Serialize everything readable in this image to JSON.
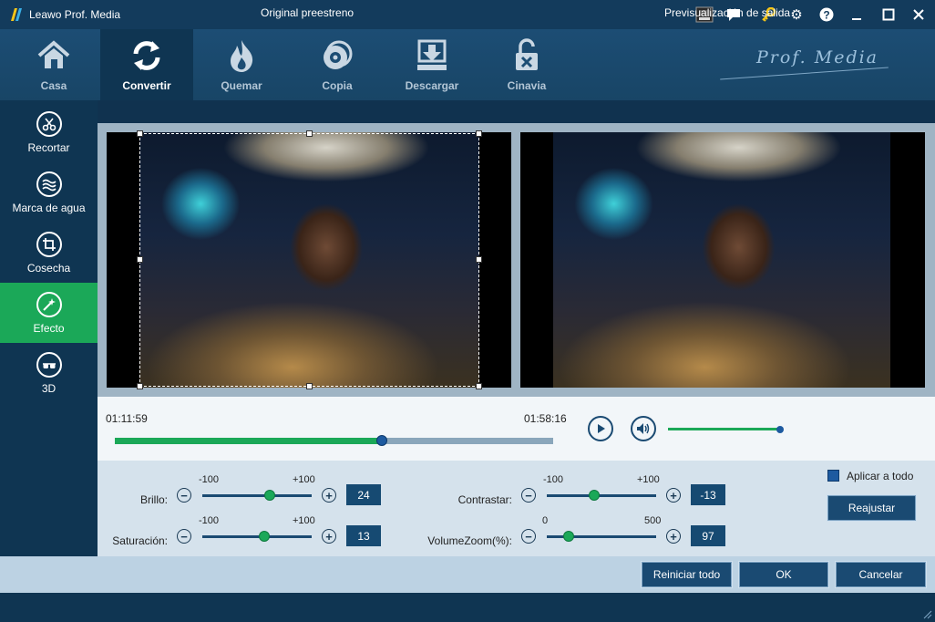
{
  "window": {
    "title": "Leawo Prof. Media",
    "controls": [
      "amd-badge-icon",
      "chat-icon",
      "key-icon",
      "gear-icon",
      "help-icon",
      "minimize-icon",
      "maximize-icon",
      "close-icon"
    ]
  },
  "nav": {
    "items": [
      {
        "label": "Casa",
        "icon": "home-icon"
      },
      {
        "label": "Convertir",
        "icon": "convert-icon",
        "active": true
      },
      {
        "label": "Quemar",
        "icon": "burn-icon"
      },
      {
        "label": "Copia",
        "icon": "copy-disc-icon"
      },
      {
        "label": "Descargar",
        "icon": "download-icon"
      },
      {
        "label": "Cinavia",
        "icon": "cinavia-unlock-icon"
      }
    ],
    "brand": "Prof. Media"
  },
  "sidebar": {
    "items": [
      {
        "label": "Recortar",
        "icon": "scissors-icon"
      },
      {
        "label": "Marca de agua",
        "icon": "watermark-icon"
      },
      {
        "label": "Cosecha",
        "icon": "crop-icon"
      },
      {
        "label": "Efecto",
        "icon": "effect-wand-icon",
        "active": true
      },
      {
        "label": "3D",
        "icon": "3d-glasses-icon"
      }
    ]
  },
  "preview": {
    "original_label": "Original preestreno",
    "output_label": "Previsualización de salida"
  },
  "timeline": {
    "current_time": "01:11:59",
    "total_time": "01:58:16",
    "progress": 0.61,
    "volume": 1.0
  },
  "settings": {
    "brightness": {
      "label": "Brillo:",
      "min": "-100",
      "max": "+100",
      "value": "24"
    },
    "saturation": {
      "label": "Saturación:",
      "min": "-100",
      "max": "+100",
      "value": "13"
    },
    "contrast": {
      "label": "Contrastar:",
      "min": "-100",
      "max": "+100",
      "value": "-13"
    },
    "volume_zoom": {
      "label": "VolumeZoom(%):",
      "min": "0",
      "max": "500",
      "value": "97"
    },
    "apply_all_label": "Aplicar a todo",
    "reset_label": "Reajustar"
  },
  "footer": {
    "reset_all_label": "Reiniciar todo",
    "ok_label": "OK",
    "cancel_label": "Cancelar"
  },
  "colors": {
    "accent_green": "#1ba858",
    "dark_blue": "#0f3552",
    "nav_blue": "#1c4d74"
  }
}
